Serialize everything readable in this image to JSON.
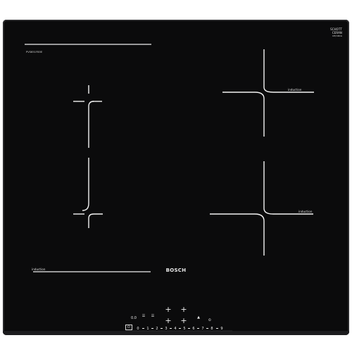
{
  "product": {
    "brand": "BOSCH",
    "model_code": "PVS651FB5E",
    "glass_mark": [
      "SCHOTT",
      "CERAN",
      "CE/UKCA"
    ]
  },
  "zones": {
    "label": "induction"
  },
  "controls": {
    "pan_symbols": [
      "☰",
      "☰"
    ],
    "min_label": "0.0",
    "plus": "+",
    "power_symbol": "⏻",
    "timer_symbol": "⏲",
    "move_symbol": "▲",
    "scale": [
      "0",
      "1",
      "2",
      "3",
      "4",
      "5",
      "6",
      "7",
      "8",
      "9"
    ]
  },
  "colors": {
    "glass": "#0b0b0c",
    "print": "#e8e8e8"
  }
}
